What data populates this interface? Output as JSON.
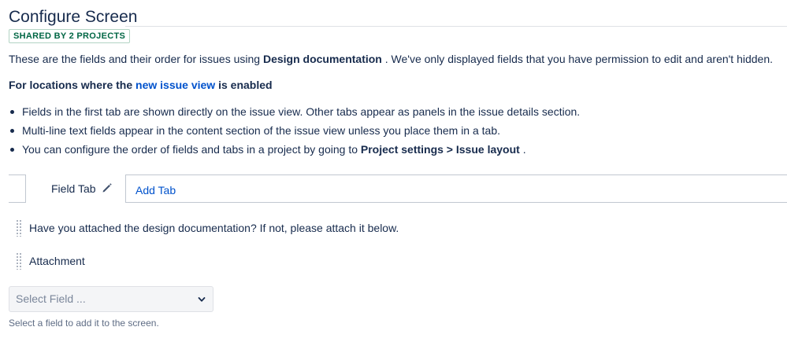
{
  "page": {
    "title": "Configure Screen",
    "badge": "SHARED BY 2 PROJECTS"
  },
  "intro": {
    "prefix": "These are the fields and their order for issues using",
    "screen_name": "Design documentation",
    "suffix": ". We've only displayed fields that you have permission to edit and aren't hidden."
  },
  "locations": {
    "prefix": "For locations where the",
    "link": "new issue view",
    "suffix": "is enabled"
  },
  "bullets": [
    {
      "text": "Fields in the first tab are shown directly on the issue view. Other tabs appear as panels in the issue details section."
    },
    {
      "text": "Multi-line text fields appear in the content section of the issue view unless you place them in a tab."
    },
    {
      "text_prefix": "You can configure the order of fields and tabs in a project by going to",
      "bold": "Project settings > Issue layout",
      "text_suffix": "."
    }
  ],
  "tabs": {
    "active": "Field Tab",
    "add": "Add Tab"
  },
  "fields": [
    {
      "label": "Have you attached the design documentation? If not, please attach it below."
    },
    {
      "label": "Attachment"
    }
  ],
  "select_field": {
    "placeholder": "Select Field ...",
    "help": "Select a field to add it to the screen."
  },
  "icons": {
    "tab_edit": "pencil-icon",
    "select_arrow": "chevron-down-icon",
    "row_handle": "drag-handle-icon"
  }
}
